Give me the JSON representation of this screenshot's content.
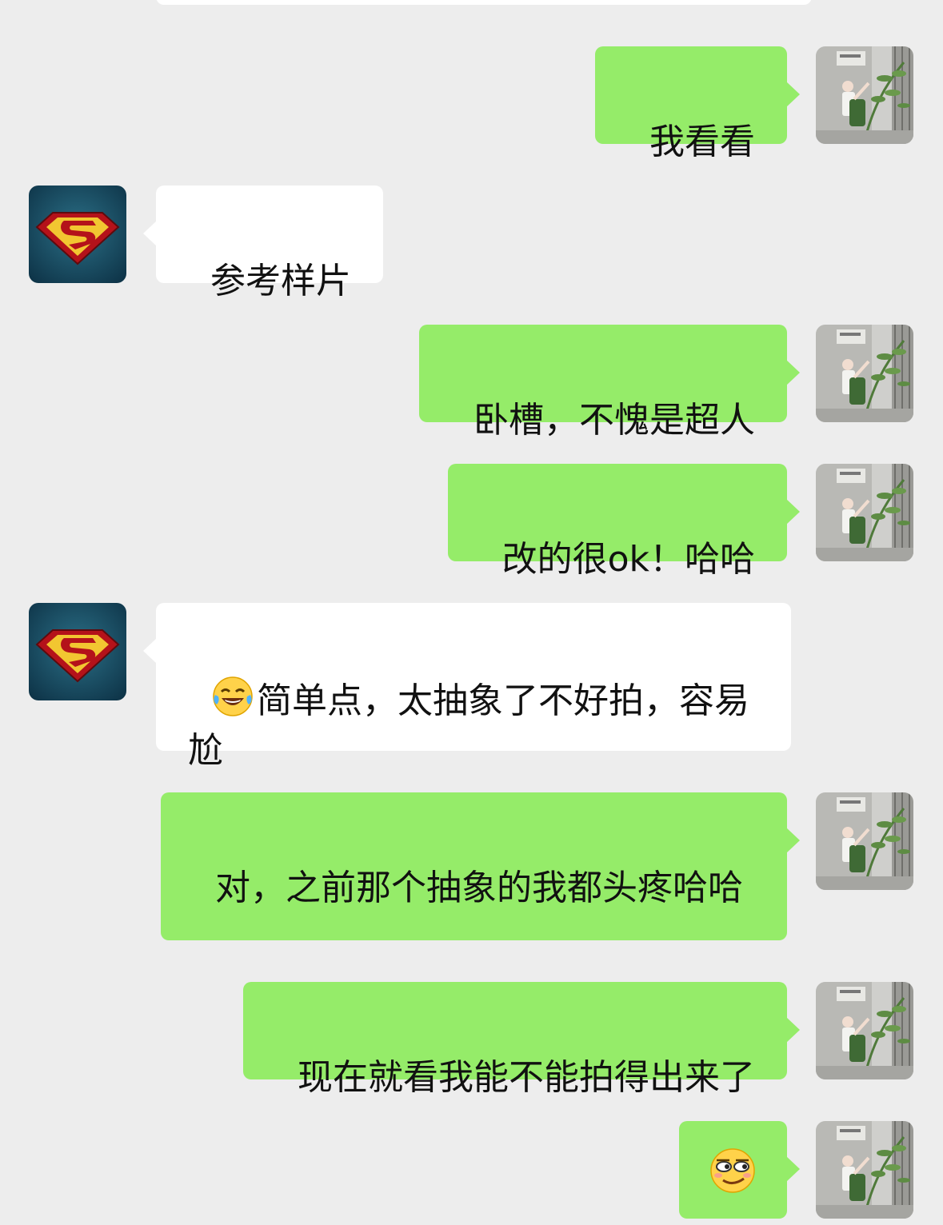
{
  "colors": {
    "background": "#ededed",
    "outgoing_bubble": "#95ec69",
    "incoming_bubble": "#ffffff"
  },
  "avatars": {
    "self": "photo-avatar-girl-in-garden",
    "other": "superman-logo-avatar"
  },
  "messages": [
    {
      "direction": "out",
      "text": "我看看"
    },
    {
      "direction": "in",
      "text": "参考样片"
    },
    {
      "direction": "out",
      "text": "卧槽，不愧是超人"
    },
    {
      "direction": "out",
      "text": "改的很ok！哈哈"
    },
    {
      "direction": "in",
      "emoji": "laughing-tears-emoji",
      "text": "简单点，太抽象了不好拍，容易尬"
    },
    {
      "direction": "out",
      "text": "对，之前那个抽象的我都头疼哈哈"
    },
    {
      "direction": "out",
      "text": "现在就看我能不能拍得出来了"
    },
    {
      "direction": "out",
      "emoji": "smirk-emoji",
      "text": ""
    }
  ]
}
